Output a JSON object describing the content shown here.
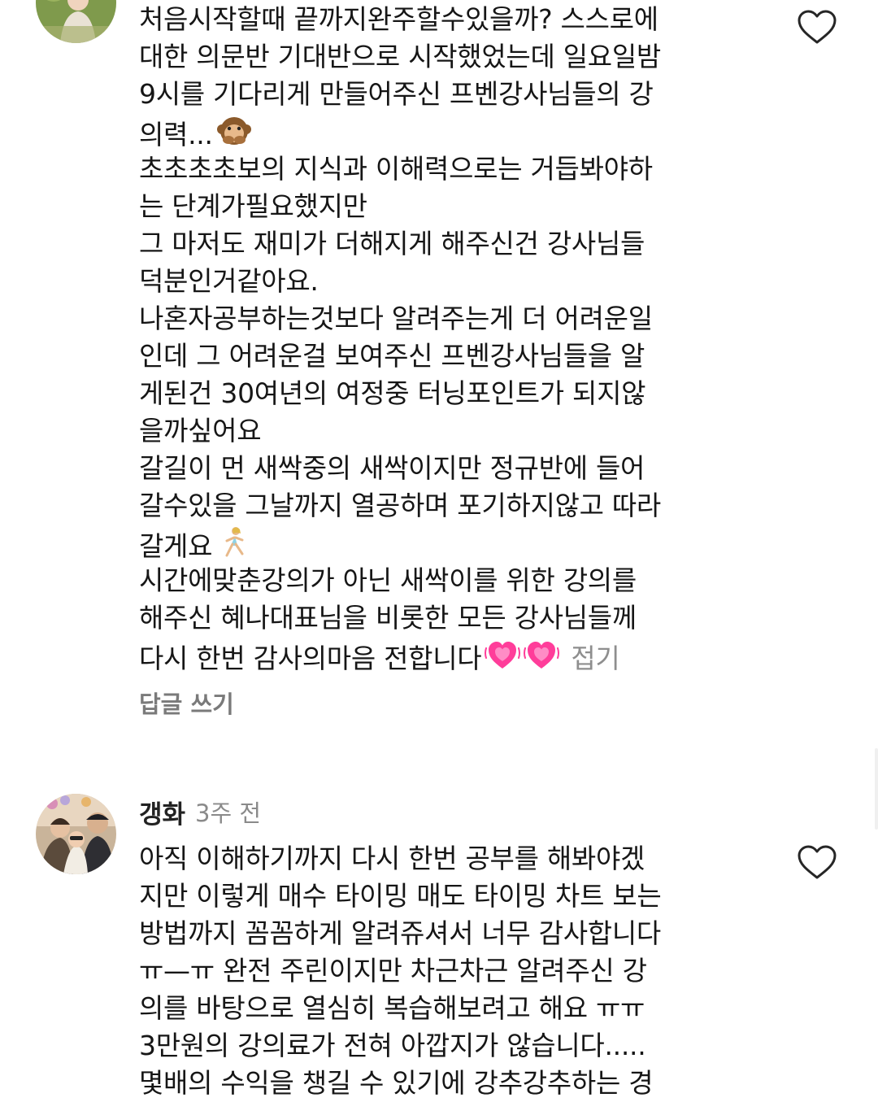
{
  "comments": [
    {
      "username": "",
      "timestamp": "",
      "lines": [
        "처음시작할때 끝까지완주할수있을까? 스스로에",
        "대한 의문반 기대반으로 시작했었는데 일요일밤",
        "9시를 기다리게 만들어주신 프벤강사님들의 강",
        "의력...",
        "초초초초보의 지식과 이해력으로는 거듭봐야하",
        "는 단계가필요했지만",
        "그 마저도 재미가 더해지게 해주신건 강사님들",
        "덕분인거같아요.",
        "나혼자공부하는것보다 알려주는게 더 어려운일",
        "인데 그 어려운걸 보여주신 프벤강사님들을 알",
        "게된건 30여년의 여정중 터닝포인트가 되지않",
        "을까싶어요",
        "갈길이 먼 새싹중의 새싹이지만 정규반에 들어",
        "갈수있을 그날까지 열공하며 포기하지않고 따라",
        "갈게요",
        "시간에맞춘강의가 아닌 새싹이를 위한 강의를",
        "해주신 혜나대표님을 비롯한 모든 강사님들께",
        "다시 한번 감사의마음 전합니다"
      ],
      "line_emojis": {
        "3": [
          "monkey-covering-mouth-icon"
        ],
        "14": [
          "woman-running-icon"
        ],
        "17": [
          "growing-heart-icon",
          "growing-heart-icon"
        ]
      },
      "collapse_label": "접기",
      "reply_label": "답글 쓰기"
    },
    {
      "username": "갱화",
      "timestamp": "3주 전",
      "lines": [
        "아직 이해하기까지 다시 한번 공부를 해봐야겠",
        "지만 이렇게 매수 타이밍 매도 타이밍 차트 보는",
        "방법까지 꼼꼼하게 알려쥬셔서 너무 감사합니다",
        "ㅠ—ㅠ 완전 주린이지만 차근차근 알려주신 강",
        "의를 바탕으로 열심히 복습해보려고 해요 ㅠㅠ",
        "3만원의 강의료가 전혀 아깝지가 않습니다.....",
        "몇배의 수익을 챙길 수 있기에 강추강추하는 경"
      ]
    }
  ],
  "colors": {
    "text": "#161616",
    "muted": "#8e8e8e",
    "heart_outline": "#262626",
    "emoji_heart": "#ff3d9a"
  }
}
